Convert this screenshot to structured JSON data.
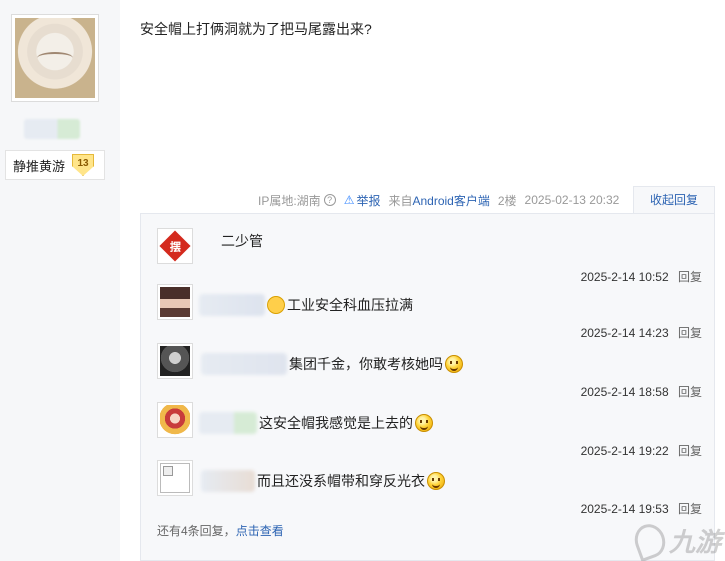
{
  "post": {
    "author_tag": "静推黄游",
    "level": "13",
    "text": "安全帽上打俩洞就为了把马尾露出来?"
  },
  "meta": {
    "ip": "IP属地:湖南",
    "report": "举报",
    "source_prefix": "来自",
    "source_link": "Android客户端",
    "floor": "2楼",
    "time": "2025-02-13 20:32",
    "collapse": "收起回复"
  },
  "replies": [
    {
      "name": "二少管",
      "text": "",
      "time": "2025-2-14 10:52",
      "reply": "回复"
    },
    {
      "name": "",
      "text": "工业安全科血压拉满",
      "time": "2025-2-14 14:23",
      "reply": "回复"
    },
    {
      "name": "",
      "text": "集团千金，你敢考核她吗",
      "time": "2025-2-14 18:58",
      "reply": "回复"
    },
    {
      "name": "",
      "text": "这安全帽我感觉是上去的",
      "time": "2025-2-14 19:22",
      "reply": "回复"
    },
    {
      "name": "",
      "text": "而且还没系帽带和穿反光衣",
      "time": "2025-2-14 19:53",
      "reply": "回复"
    }
  ],
  "more": {
    "prefix": "还有4条回复，",
    "link": "点击查看"
  },
  "watermark": "九游",
  "colors": {
    "link": "#2d64b3",
    "reply_bg": "#f7f8fa"
  }
}
